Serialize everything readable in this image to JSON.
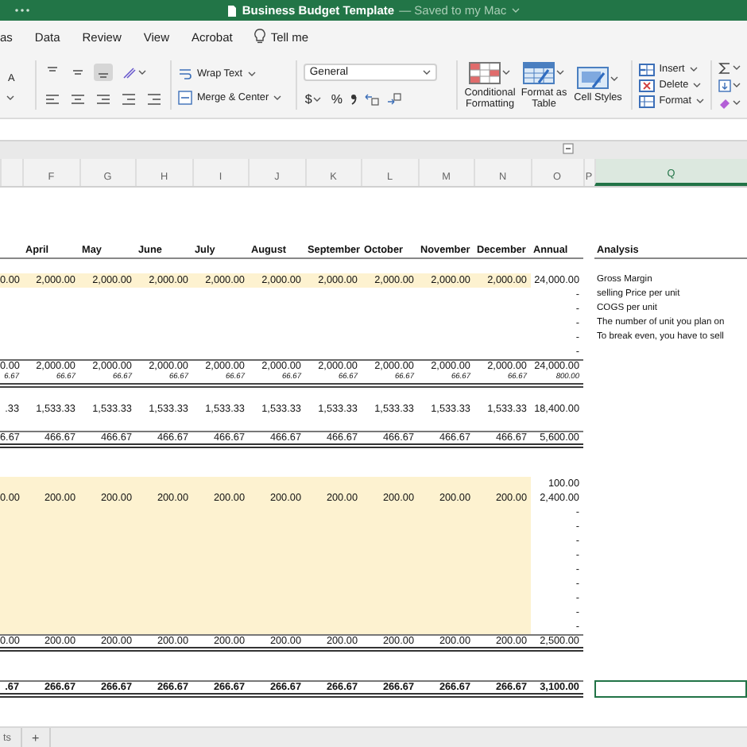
{
  "title_bar": {
    "title": "Business Budget Template",
    "status": "— Saved to my Mac"
  },
  "menu": [
    "as",
    "Data",
    "Review",
    "View",
    "Acrobat"
  ],
  "tell_me": "Tell me",
  "ribbon": {
    "font_grow": "A",
    "vertical_align": [
      {
        "selected": false
      },
      {
        "selected": false
      },
      {
        "selected": true
      }
    ],
    "wrap_text": "Wrap Text",
    "merge": "Merge & Center",
    "number_format": "General",
    "currency": "$",
    "percent": "%",
    "styles": [
      {
        "label": "Conditional Formatting",
        "kind": "conditional"
      },
      {
        "label": "Format as Table",
        "kind": "table"
      },
      {
        "label": "Cell Styles",
        "kind": "styles"
      }
    ],
    "cell_actions": [
      {
        "label": "Insert",
        "kind": "insert"
      },
      {
        "label": "Delete",
        "kind": "delete"
      },
      {
        "label": "Format",
        "kind": "format"
      }
    ]
  },
  "sheet": {
    "columns": [
      {
        "label": "F",
        "selected": false
      },
      {
        "label": "G",
        "selected": false
      },
      {
        "label": "H",
        "selected": false
      },
      {
        "label": "I",
        "selected": false
      },
      {
        "label": "J",
        "selected": false
      },
      {
        "label": "K",
        "selected": false
      },
      {
        "label": "L",
        "selected": false
      },
      {
        "label": "M",
        "selected": false
      },
      {
        "label": "N",
        "selected": false
      },
      {
        "label": "O",
        "selected": false
      },
      {
        "label": "P",
        "selected": false
      },
      {
        "label": "Q",
        "selected": true
      }
    ],
    "rows": [
      {
        "kind": "blank",
        "selected": false
      },
      {
        "kind": "blank",
        "selected": false
      },
      {
        "kind": "blank",
        "selected": false
      },
      {
        "kind": "blank",
        "selected": false
      },
      {
        "kind": "header",
        "selected": false,
        "cells": [
          null,
          "April",
          "May",
          "June",
          "July",
          "August",
          "September",
          "October",
          "November",
          "December"
        ],
        "annual": "Annual",
        "analysis": "Analysis"
      },
      {
        "kind": "blank",
        "selected": false
      },
      {
        "kind": "input",
        "selected": false,
        "cells": [
          "0.00",
          "2,000.00",
          "2,000.00",
          "2,000.00",
          "2,000.00",
          "2,000.00",
          "2,000.00",
          "2,000.00",
          "2,000.00",
          "2,000.00"
        ],
        "annual": "24,000.00",
        "analysis": "Gross Margin"
      },
      {
        "kind": "value",
        "selected": false,
        "annual": "-",
        "analysis": "selling Price per unit"
      },
      {
        "kind": "value",
        "selected": false,
        "annual": "-",
        "analysis": "COGS per unit"
      },
      {
        "kind": "value",
        "selected": false,
        "annual": "-",
        "analysis": "The number of unit you plan on"
      },
      {
        "kind": "value",
        "selected": false,
        "annual": "-",
        "analysis": "To break even, you have to sell"
      },
      {
        "kind": "value",
        "selected": false,
        "annual": "-"
      },
      {
        "kind": "total",
        "selected": false,
        "cells": [
          "0.00",
          "2,000.00",
          "2,000.00",
          "2,000.00",
          "2,000.00",
          "2,000.00",
          "2,000.00",
          "2,000.00",
          "2,000.00",
          "2,000.00"
        ],
        "annual": "24,000.00"
      },
      {
        "kind": "italic",
        "selected": false,
        "cells": [
          "6.67",
          "66.67",
          "66.67",
          "66.67",
          "66.67",
          "66.67",
          "66.67",
          "66.67",
          "66.67",
          "66.67"
        ],
        "annual": "800.00"
      },
      {
        "kind": "blank",
        "selected": false
      },
      {
        "kind": "value",
        "selected": false,
        "cells": [
          ".33",
          "1,533.33",
          "1,533.33",
          "1,533.33",
          "1,533.33",
          "1,533.33",
          "1,533.33",
          "1,533.33",
          "1,533.33",
          "1,533.33"
        ],
        "annual": "18,400.00"
      },
      {
        "kind": "blank",
        "selected": false
      },
      {
        "kind": "net",
        "selected": false,
        "cells": [
          "6.67",
          "466.67",
          "466.67",
          "466.67",
          "466.67",
          "466.67",
          "466.67",
          "466.67",
          "466.67",
          "466.67"
        ],
        "annual": "5,600.00"
      },
      {
        "kind": "blank",
        "selected": false
      },
      {
        "kind": "blank",
        "selected": false
      },
      {
        "kind": "input",
        "selected": false,
        "annual": "100.00"
      },
      {
        "kind": "input",
        "selected": false,
        "cells": [
          "0.00",
          "200.00",
          "200.00",
          "200.00",
          "200.00",
          "200.00",
          "200.00",
          "200.00",
          "200.00",
          "200.00"
        ],
        "annual": "2,400.00"
      },
      {
        "kind": "input",
        "selected": false,
        "annual": "-"
      },
      {
        "kind": "input",
        "selected": false,
        "annual": "-"
      },
      {
        "kind": "input",
        "selected": false,
        "annual": "-"
      },
      {
        "kind": "input",
        "selected": false,
        "annual": "-"
      },
      {
        "kind": "input",
        "selected": false,
        "annual": "-"
      },
      {
        "kind": "input",
        "selected": false,
        "annual": "-"
      },
      {
        "kind": "input",
        "selected": false,
        "annual": "-"
      },
      {
        "kind": "input",
        "selected": false,
        "annual": "-"
      },
      {
        "kind": "input",
        "selected": false,
        "annual": "-"
      },
      {
        "kind": "net",
        "selected": false,
        "cells": [
          "0.00",
          "200.00",
          "200.00",
          "200.00",
          "200.00",
          "200.00",
          "200.00",
          "200.00",
          "200.00",
          "200.00"
        ],
        "annual": "2,500.00"
      },
      {
        "kind": "blank",
        "selected": false
      },
      {
        "kind": "blank",
        "selected": false
      },
      {
        "kind": "net-bold",
        "selected": true,
        "cells": [
          ".67",
          "266.67",
          "266.67",
          "266.67",
          "266.67",
          "266.67",
          "266.67",
          "266.67",
          "266.67",
          "266.67"
        ],
        "annual": "3,100.00"
      },
      {
        "kind": "blank",
        "selected": false
      },
      {
        "kind": "blank",
        "selected": false
      }
    ]
  },
  "sheet_tabs": [
    {
      "label": "ts"
    }
  ],
  "add_sheet": "+"
}
